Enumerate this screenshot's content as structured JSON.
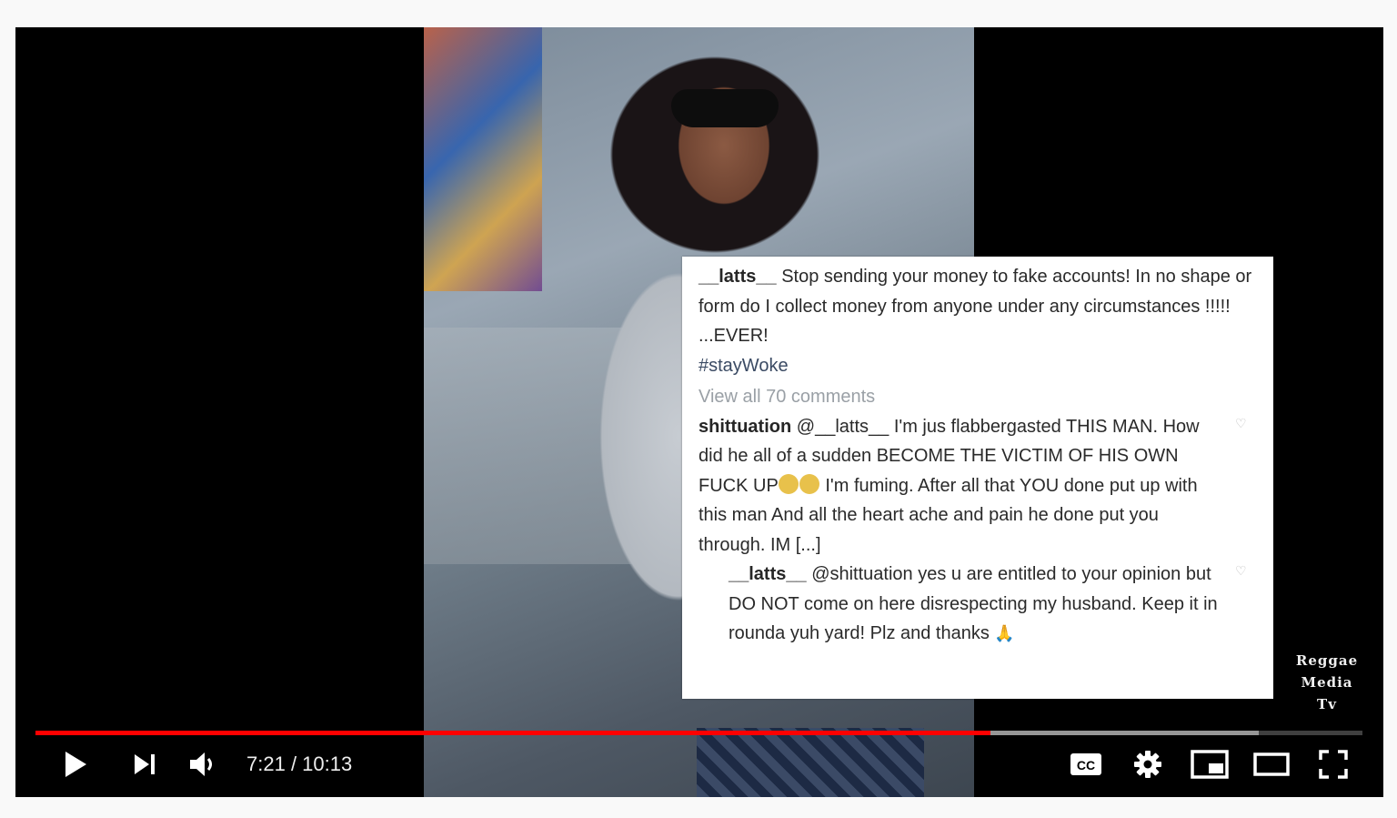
{
  "post": {
    "caption_user": "__latts__",
    "caption_text": "Stop sending your money to fake accounts! In no shape or form do I collect money from anyone under any circumstances !!!!! ...EVER!",
    "hashtag": "#stayWoke",
    "view_all": "View all 70 comments",
    "comment1_user": "shittuation",
    "comment1_mention": "@__latts__",
    "comment1_text_a": "I'm jus flabbergasted THIS MAN. How did he all of a sudden BECOME THE VICTIM OF HIS OWN FUCK UP",
    "comment1_text_b": "I'm fuming. After all that YOU done put up with this man And all the heart ache and pain he done put you through. IM [...]",
    "reply_user": "__latts__",
    "reply_mention": "@shittuation",
    "reply_text": "yes u are entitled to your opinion but DO NOT come on here disrespecting my husband. Keep it in rounda yuh yard! Plz and thanks",
    "reply_emoji": "🙏"
  },
  "watermark": [
    "Reggae",
    "Media",
    "Tv"
  ],
  "player": {
    "time_current": "7:21",
    "time_separator": " / ",
    "time_total": "10:13",
    "played_fraction": 0.7196,
    "buffered_fraction": 0.922
  },
  "icons": {
    "play": "play-icon",
    "next": "next-icon",
    "volume": "volume-icon",
    "cc": "captions-icon",
    "settings": "gear-icon",
    "miniplayer": "miniplayer-icon",
    "theater": "theater-icon",
    "fullscreen": "fullscreen-icon"
  },
  "colors": {
    "progress_played": "#ff0000"
  }
}
